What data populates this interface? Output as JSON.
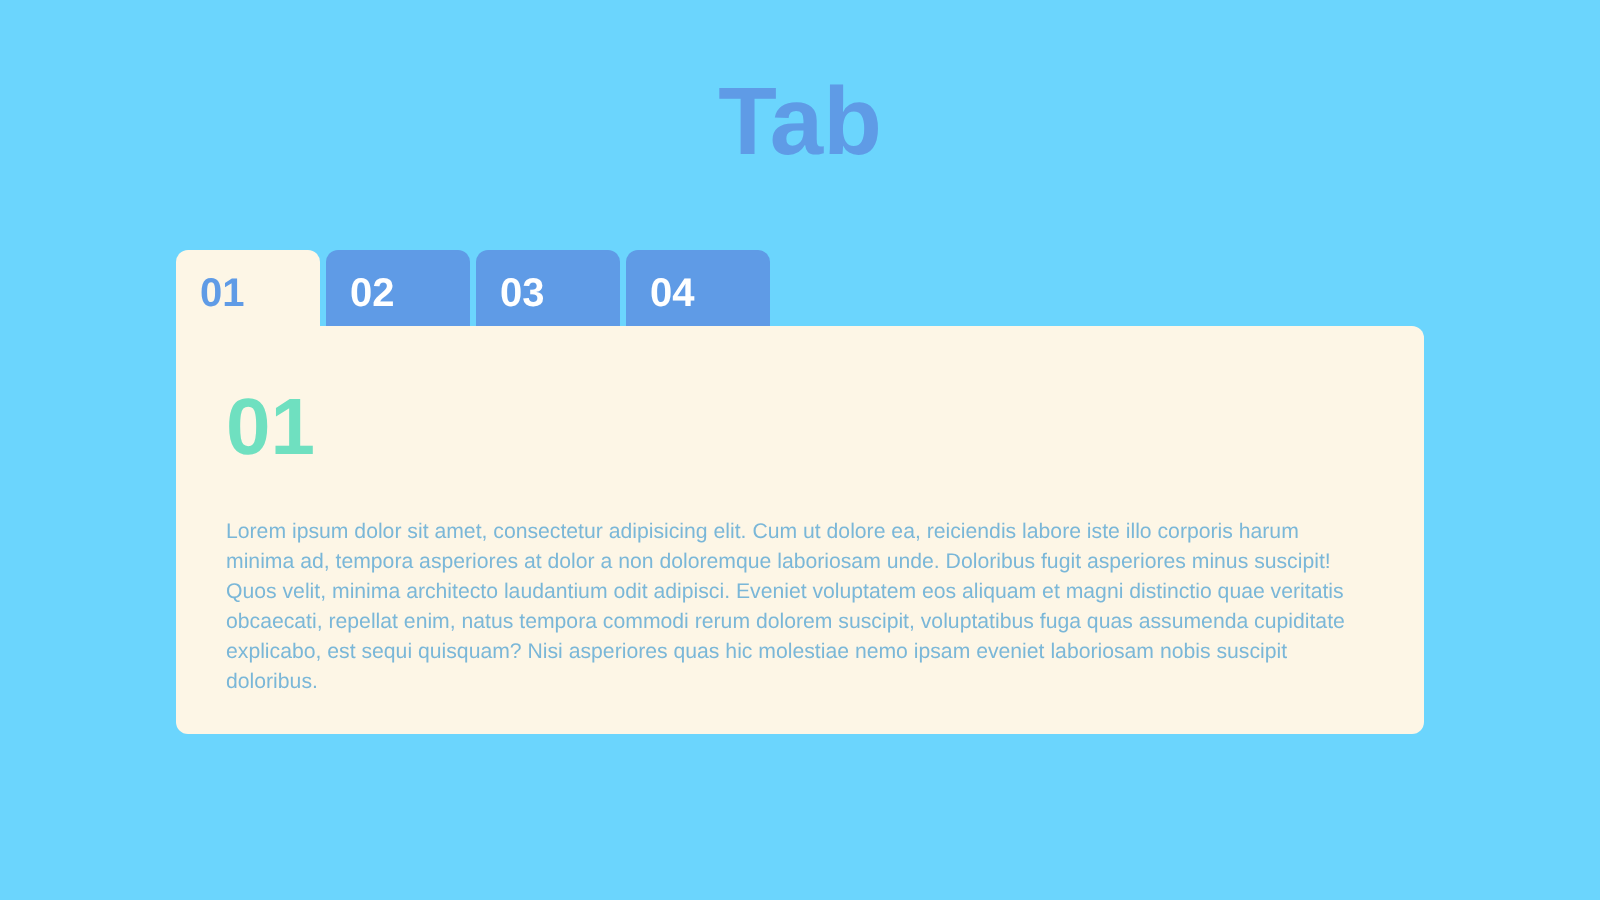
{
  "title": "Tab",
  "tabs": [
    {
      "label": "01",
      "selected": true
    },
    {
      "label": "02",
      "selected": false
    },
    {
      "label": "03",
      "selected": false
    },
    {
      "label": "04",
      "selected": false
    }
  ],
  "panel": {
    "heading": "01",
    "text": "Lorem ipsum dolor sit amet, consectetur adipisicing elit. Cum ut dolore ea, reiciendis labore iste illo corporis harum minima ad, tempora asperiores at dolor a non doloremque laboriosam unde. Doloribus fugit asperiores minus suscipit! Quos velit, minima architecto laudantium odit adipisci. Eveniet voluptatem eos aliquam et magni distinctio quae veritatis obcaecati, repellat enim, natus tempora commodi rerum dolorem suscipit, voluptatibus fuga quas assumenda cupiditate explicabo, est sequi quisquam? Nisi asperiores quas hic molestiae nemo ipsam eveniet laboriosam nobis suscipit doloribus."
  }
}
